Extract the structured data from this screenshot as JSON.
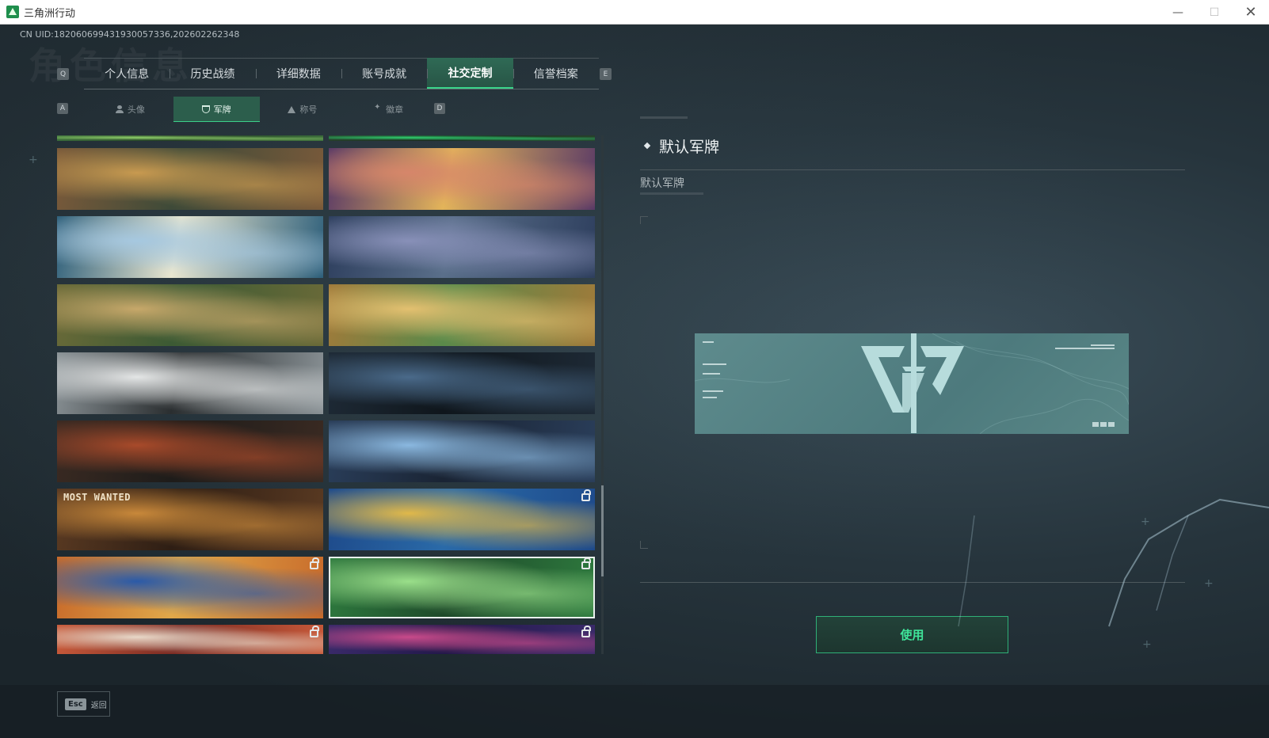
{
  "window": {
    "title": "三角洲行动",
    "minimize": "—",
    "maximize": "☐",
    "close": "✕"
  },
  "header": {
    "uid": "CN UID:18206069943193005733​6,202602262348",
    "bg_title": "角色信息"
  },
  "top_tabs": {
    "prev_key": "Q",
    "next_key": "E",
    "items": [
      {
        "label": "个人信息",
        "active": false
      },
      {
        "label": "历史战绩",
        "active": false
      },
      {
        "label": "详细数据",
        "active": false
      },
      {
        "label": "账号成就",
        "active": false
      },
      {
        "label": "社交定制",
        "active": true
      },
      {
        "label": "信誉档案",
        "active": false
      }
    ]
  },
  "sub_tabs": {
    "prev_key": "A",
    "next_key": "D",
    "items": [
      {
        "label": "头像",
        "icon": "person-icon",
        "active": false
      },
      {
        "label": "军牌",
        "icon": "badge-icon",
        "active": true
      },
      {
        "label": "称号",
        "icon": "triangle-icon",
        "active": false
      },
      {
        "label": "徽章",
        "icon": "wings-icon",
        "active": false
      }
    ]
  },
  "cards": [
    {
      "name": "card-partial-top-left",
      "colors": [
        "#3a6b3a",
        "#8fd06a",
        "#213a22"
      ],
      "locked": false
    },
    {
      "name": "card-partial-top-right",
      "colors": [
        "#26402a",
        "#2fd070",
        "#1a2a1e"
      ],
      "locked": false
    },
    {
      "name": "card-soldiers-firefight",
      "colors": [
        "#7a5a3a",
        "#c89a50",
        "#3e4a38"
      ],
      "locked": false
    },
    {
      "name": "card-party-celebration",
      "colors": [
        "#5a3a66",
        "#d6866a",
        "#e3b45a"
      ],
      "locked": false
    },
    {
      "name": "card-archer-stadium",
      "colors": [
        "#2e5f7a",
        "#a6c8e0",
        "#e8e6d0"
      ],
      "locked": false
    },
    {
      "name": "card-chibi-operator",
      "colors": [
        "#2e3f5e",
        "#8890b8",
        "#5a6f8a"
      ],
      "locked": false
    },
    {
      "name": "card-flower-field",
      "colors": [
        "#6a6a38",
        "#c7a86a",
        "#3c5a34"
      ],
      "locked": false
    },
    {
      "name": "card-kitchen-frogs",
      "colors": [
        "#a07a3a",
        "#e3c070",
        "#5a8a4a"
      ],
      "locked": false
    },
    {
      "name": "card-chibi-redhead",
      "colors": [
        "#8a9296",
        "#e4e6e6",
        "#2a2e30"
      ],
      "locked": false
    },
    {
      "name": "card-knife-night",
      "colors": [
        "#1e2a36",
        "#4a6a8a",
        "#0f161c"
      ],
      "locked": false
    },
    {
      "name": "card-graffiti-gunner",
      "colors": [
        "#3a2a22",
        "#a84a2a",
        "#1e1c1a"
      ],
      "locked": false
    },
    {
      "name": "card-ice-axe",
      "colors": [
        "#2a3e5a",
        "#8ab8e0",
        "#1a2434"
      ],
      "locked": false
    },
    {
      "name": "card-most-wanted",
      "colors": [
        "#5a3a22",
        "#c8883a",
        "#2e1e14"
      ],
      "locked": false,
      "caption": "MOST WANTED"
    },
    {
      "name": "card-blue-crossbow",
      "colors": [
        "#1e4a8a",
        "#e0b84a",
        "#2a6aa8"
      ],
      "locked": true
    },
    {
      "name": "card-orange-rifle",
      "colors": [
        "#c86a2a",
        "#2a5aa8",
        "#e0a84a"
      ],
      "locked": true
    },
    {
      "name": "card-green-swirl",
      "colors": [
        "#2e7a3e",
        "#9adf8a",
        "#1e4a2a"
      ],
      "locked": true,
      "selected": true
    },
    {
      "name": "card-red-jet",
      "colors": [
        "#c85a3a",
        "#e8d8c8",
        "#7a2a22"
      ],
      "locked": true
    },
    {
      "name": "card-purple-device",
      "colors": [
        "#3a2a6a",
        "#c84a8a",
        "#22184a"
      ],
      "locked": true
    }
  ],
  "detail": {
    "title": "默认军牌",
    "subtitle": "默认军牌",
    "use_button": "使用"
  },
  "footer": {
    "esc_key": "Esc",
    "esc_label": "返回"
  }
}
